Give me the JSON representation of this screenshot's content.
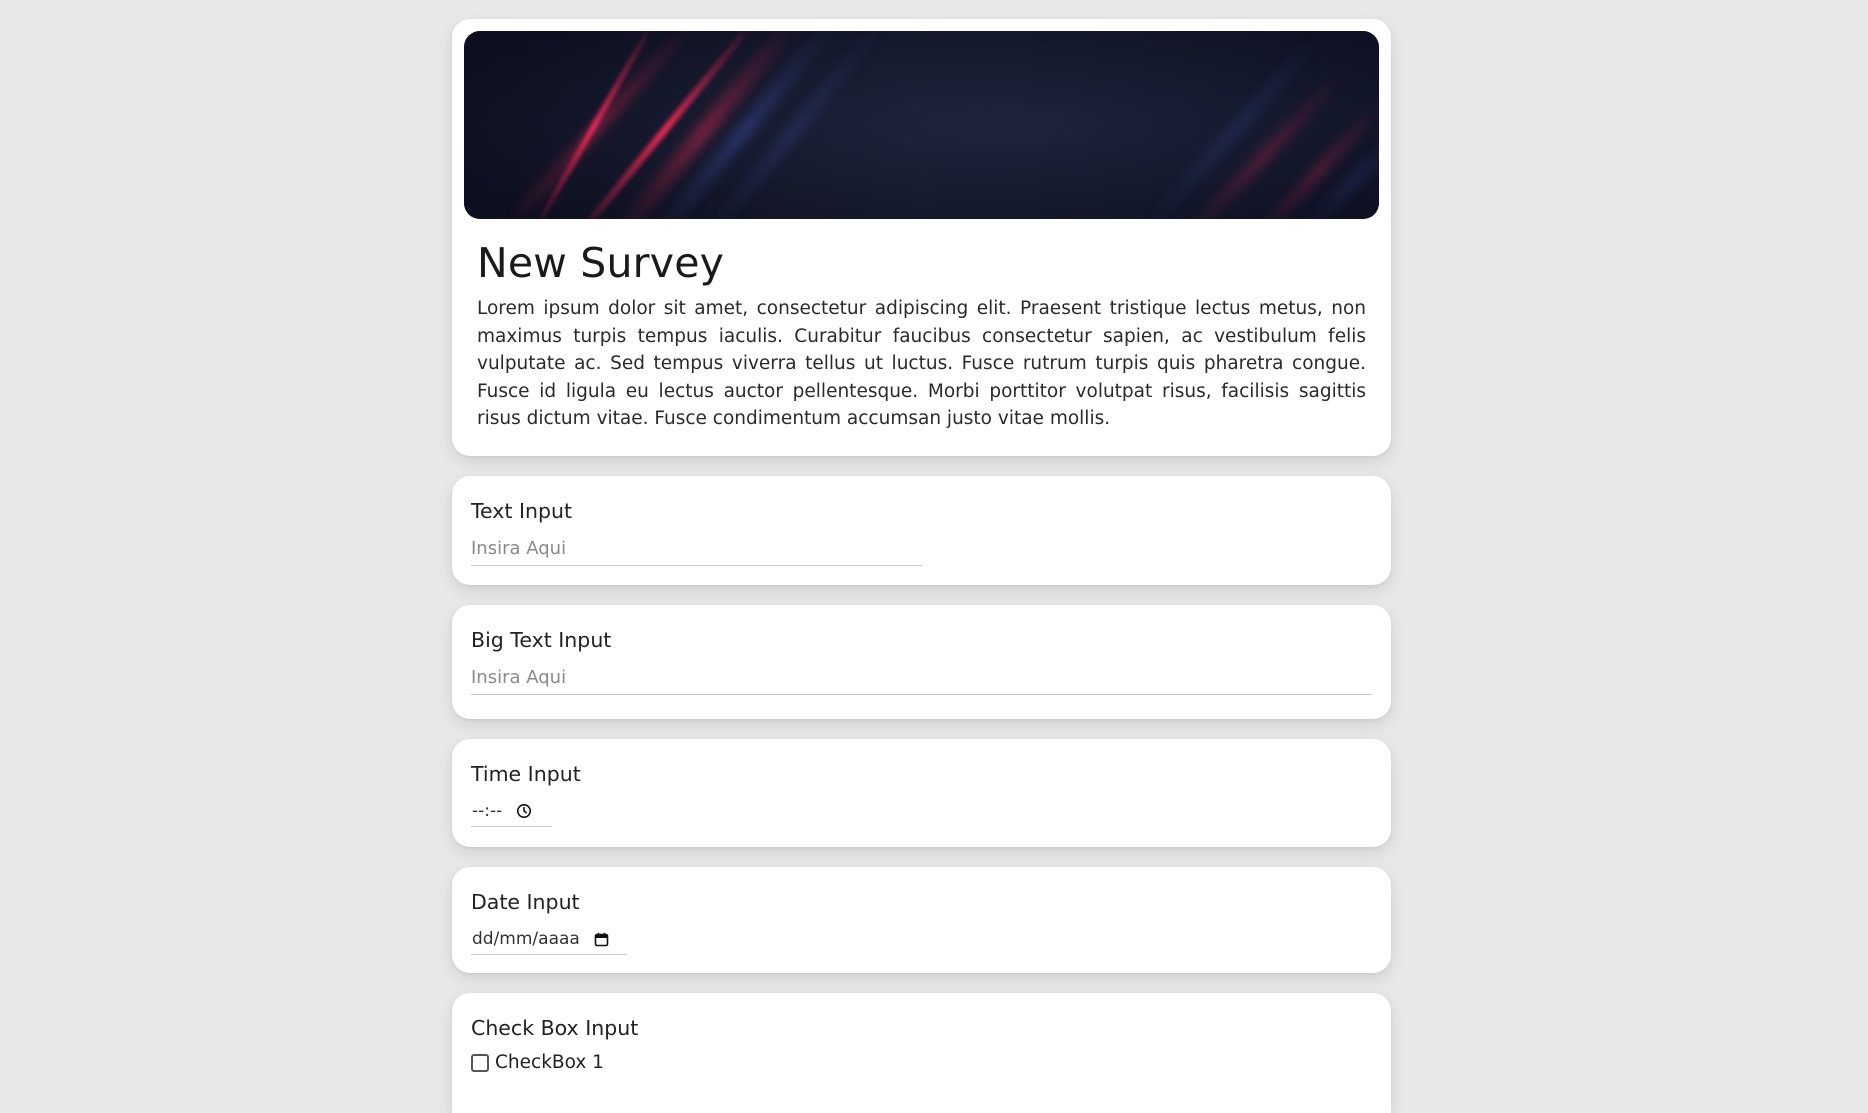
{
  "survey": {
    "title": "New Survey",
    "description": "Lorem ipsum dolor sit amet, consectetur adipiscing elit. Praesent tristique lectus metus, non maximus turpis tempus iaculis. Curabitur faucibus consectetur sapien, ac vestibulum felis vulputate ac. Sed tempus viverra tellus ut luctus. Fusce rutrum turpis quis pharetra congue. Fusce id ligula eu lectus auctor pellentesque. Morbi porttitor volutpat risus, facilisis sagittis risus dictum vitae. Fusce condimentum accumsan justo vitae mollis."
  },
  "questions": {
    "text_input": {
      "label": "Text Input",
      "placeholder": "Insira Aqui"
    },
    "big_text_input": {
      "label": "Big Text Input",
      "placeholder": "Insira Aqui"
    },
    "time_input": {
      "label": "Time Input",
      "value": "--:--",
      "icon": "clock-icon"
    },
    "date_input": {
      "label": "Date Input",
      "value": "dd/mm/aaaa",
      "icon": "calendar-icon"
    },
    "checkbox_input": {
      "label": "Check Box Input",
      "options": [
        {
          "label": "CheckBox 1",
          "checked": false
        }
      ]
    }
  },
  "colors": {
    "page_background": "#e9e8e9",
    "card_background": "#ffffff",
    "banner_dark": "#1a1f33",
    "banner_accent_red": "#e8234f",
    "banner_accent_blue": "#2c3a7a"
  }
}
